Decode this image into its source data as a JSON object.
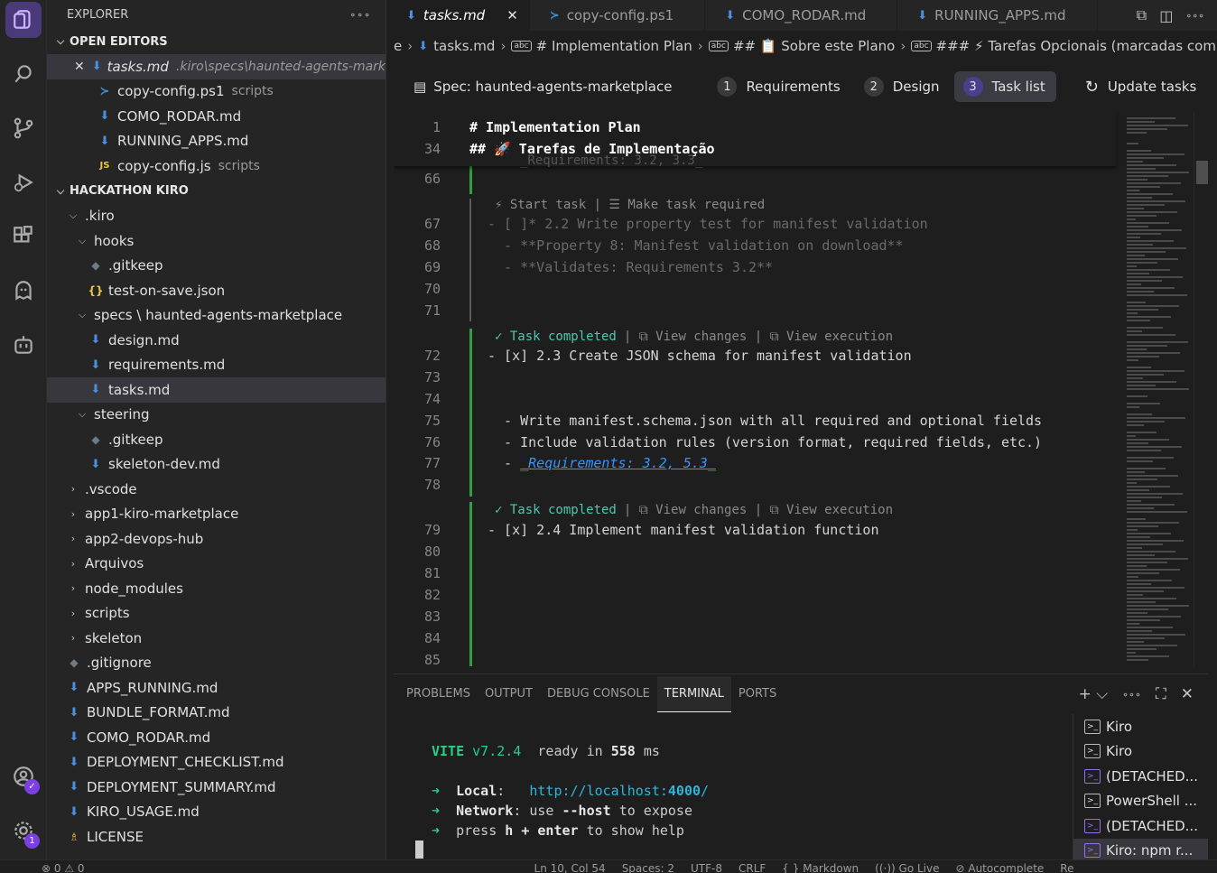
{
  "explorer": {
    "title": "EXPLORER",
    "more": "∘∘∘",
    "open_editors_label": "OPEN EDITORS",
    "open_editors": [
      {
        "name": "tasks.md",
        "desc": ".kiro\\specs\\haunted-agents-mark...",
        "icon": "markdown-icon"
      },
      {
        "name": "copy-config.ps1",
        "desc": "scripts",
        "icon": "powershell-icon"
      },
      {
        "name": "COMO_RODAR.md",
        "desc": "",
        "icon": "markdown-icon"
      },
      {
        "name": "RUNNING_APPS.md",
        "desc": "",
        "icon": "markdown-icon"
      },
      {
        "name": "copy-config.js",
        "desc": "scripts",
        "icon": "javascript-icon"
      }
    ],
    "workspace_label": "HACKATHON KIRO",
    "tree": [
      {
        "name": ".kiro",
        "indent": 1,
        "type": "folder-open"
      },
      {
        "name": "hooks",
        "indent": 2,
        "type": "folder-open"
      },
      {
        "name": ".gitkeep",
        "indent": 3,
        "type": "git"
      },
      {
        "name": "test-on-save.json",
        "indent": 3,
        "type": "json"
      },
      {
        "name": "specs \\ haunted-agents-marketplace",
        "indent": 2,
        "type": "folder-open"
      },
      {
        "name": "design.md",
        "indent": 3,
        "type": "md"
      },
      {
        "name": "requirements.md",
        "indent": 3,
        "type": "md"
      },
      {
        "name": "tasks.md",
        "indent": 3,
        "type": "md",
        "selected": true
      },
      {
        "name": "steering",
        "indent": 2,
        "type": "folder-open"
      },
      {
        "name": ".gitkeep",
        "indent": 3,
        "type": "git"
      },
      {
        "name": "skeleton-dev.md",
        "indent": 3,
        "type": "md"
      },
      {
        "name": ".vscode",
        "indent": 1,
        "type": "folder"
      },
      {
        "name": "app1-kiro-marketplace",
        "indent": 1,
        "type": "folder"
      },
      {
        "name": "app2-devops-hub",
        "indent": 1,
        "type": "folder"
      },
      {
        "name": "Arquivos",
        "indent": 1,
        "type": "folder"
      },
      {
        "name": "node_modules",
        "indent": 1,
        "type": "folder"
      },
      {
        "name": "scripts",
        "indent": 1,
        "type": "folder"
      },
      {
        "name": "skeleton",
        "indent": 1,
        "type": "folder"
      },
      {
        "name": ".gitignore",
        "indent": 1,
        "type": "git"
      },
      {
        "name": "APPS_RUNNING.md",
        "indent": 1,
        "type": "md"
      },
      {
        "name": "BUNDLE_FORMAT.md",
        "indent": 1,
        "type": "md"
      },
      {
        "name": "COMO_RODAR.md",
        "indent": 1,
        "type": "md"
      },
      {
        "name": "DEPLOYMENT_CHECKLIST.md",
        "indent": 1,
        "type": "md"
      },
      {
        "name": "DEPLOYMENT_SUMMARY.md",
        "indent": 1,
        "type": "md"
      },
      {
        "name": "KIRO_USAGE.md",
        "indent": 1,
        "type": "md"
      },
      {
        "name": "LICENSE",
        "indent": 1,
        "type": "license"
      }
    ]
  },
  "tabs": [
    {
      "label": "tasks.md",
      "icon": "markdown-icon",
      "active": true
    },
    {
      "label": "copy-config.ps1",
      "icon": "powershell-icon",
      "active": false
    },
    {
      "label": "COMO_RODAR.md",
      "icon": "markdown-icon",
      "active": false
    },
    {
      "label": "RUNNING_APPS.md",
      "icon": "markdown-icon",
      "active": false
    }
  ],
  "breadcrumb": {
    "items": [
      "e",
      "tasks.md",
      "# Implementation Plan",
      "## 📋 Sobre este Plano",
      "### ⚡ Tarefas Opcionais (marcadas com *)"
    ],
    "item_badge": "abc"
  },
  "spec_bar": {
    "title": "Spec: haunted-agents-marketplace",
    "steps": [
      {
        "num": "1",
        "label": "Requirements",
        "active": false
      },
      {
        "num": "2",
        "label": "Design",
        "active": false
      },
      {
        "num": "3",
        "label": "Task list",
        "active": true
      }
    ],
    "update": "Update tasks"
  },
  "editor": {
    "sticky": [
      {
        "num": "1",
        "text": "# Implementation Plan"
      },
      {
        "num": "34",
        "text": "## 🚀 Tarefas de Implementação"
      }
    ],
    "peek_text": "_Requirements: 3.2, 3.3_",
    "lines": [
      {
        "num": "66",
        "text": ""
      },
      {
        "num": "67",
        "text": "- [ ]* 2.2 Write property test for manifest validation",
        "dim": true
      },
      {
        "num": "68",
        "text": "  - **Property 8: Manifest validation on download**",
        "dim": true
      },
      {
        "num": "69",
        "text": "  - **Validates: Requirements 3.2**",
        "dim": true
      },
      {
        "num": "70",
        "text": ""
      },
      {
        "num": "71",
        "text": ""
      },
      {
        "num": "72",
        "text": "- [x] 2.3 Create JSON schema for manifest validation"
      },
      {
        "num": "73",
        "text": ""
      },
      {
        "num": "74",
        "text": ""
      },
      {
        "num": "75",
        "text": "  - Write manifest.schema.json with all required and optional fields"
      },
      {
        "num": "76",
        "text": "  - Include validation rules (version format, required fields, etc.)"
      },
      {
        "num": "77",
        "text": "  - ",
        "link": "_Requirements: 3.2, 5.3_"
      },
      {
        "num": "78",
        "text": ""
      },
      {
        "num": "79",
        "text": "- [x] 2.4 Implement manifest validation function"
      },
      {
        "num": "80",
        "text": ""
      },
      {
        "num": "81",
        "text": ""
      },
      {
        "num": "82",
        "text": ""
      },
      {
        "num": "83",
        "text": ""
      },
      {
        "num": "84",
        "text": ""
      },
      {
        "num": "85",
        "text": ""
      }
    ],
    "codelens_pending": "Start task | ☰ Make task required",
    "codelens_done_label": "Task completed",
    "codelens_done_rest": "| ⧉ View changes | ⧉ View execution"
  },
  "panel": {
    "tabs": [
      "PROBLEMS",
      "OUTPUT",
      "DEBUG CONSOLE",
      "TERMINAL",
      "PORTS"
    ],
    "active_tab": "TERMINAL",
    "terminal": {
      "vite_name": "VITE",
      "vite_version": "v7.2.4",
      "ready_text": "ready in",
      "ready_ms": "558",
      "ms": "ms",
      "local_label": "Local",
      "local_url_pre": "http://localhost:",
      "local_port": "4000",
      "local_url_post": "/",
      "network_label": "Network",
      "network_text": "use",
      "network_flag": "--host",
      "network_rest": "to expose",
      "help_pre": "press",
      "help_key": "h",
      "help_plus": "+",
      "help_enter": "enter",
      "help_rest": "to show help"
    },
    "terminals": [
      {
        "label": "Kiro",
        "purple": false,
        "selected": false
      },
      {
        "label": "Kiro",
        "purple": false,
        "selected": false
      },
      {
        "label": "(DETACHED...",
        "purple": true,
        "selected": false
      },
      {
        "label": "PowerShell ...",
        "purple": false,
        "selected": false
      },
      {
        "label": "(DETACHED...",
        "purple": true,
        "selected": false
      },
      {
        "label": "Kiro: npm r...",
        "purple": true,
        "selected": true
      }
    ]
  },
  "status": {
    "errors": "⊗ 0 ⚠ 0",
    "position": "Ln 10, Col 54",
    "spaces": "Spaces: 2",
    "encoding": "UTF-8",
    "eol": "CRLF",
    "language": "{ } Markdown",
    "golive": "((·)) Go Live",
    "autocomplete": "⊘ Autocomplete",
    "extra": "Re"
  },
  "activity_badges": {
    "account": "✓",
    "settings": "1"
  },
  "colors": {
    "accent": "#7b3fe4",
    "link": "#3794ff",
    "success": "#2ea043"
  }
}
